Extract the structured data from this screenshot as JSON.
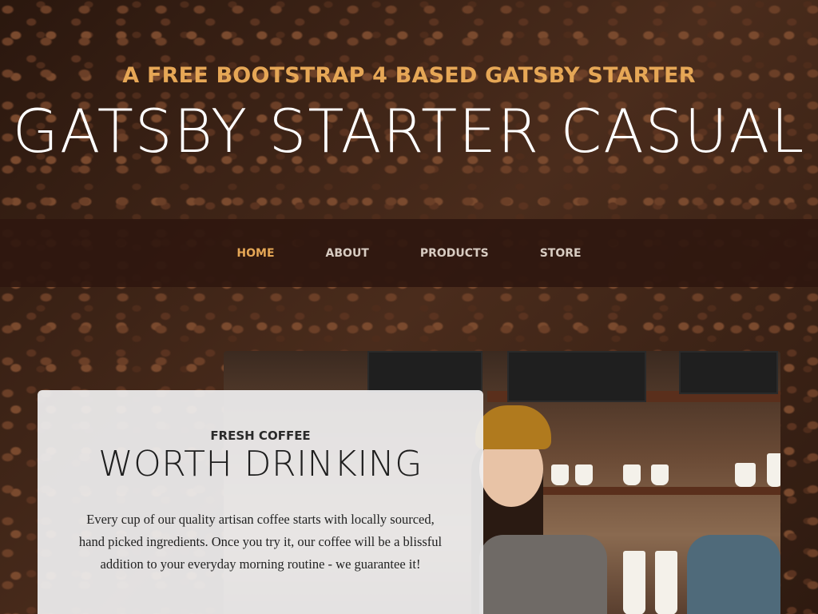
{
  "header": {
    "tagline": "A FREE BOOTSTRAP 4 BASED GATSBY STARTER",
    "site_title": "GATSBY STARTER CASUAL"
  },
  "nav": {
    "items": [
      {
        "label": "HOME",
        "active": true
      },
      {
        "label": "ABOUT",
        "active": false
      },
      {
        "label": "PRODUCTS",
        "active": false
      },
      {
        "label": "STORE",
        "active": false
      }
    ]
  },
  "intro": {
    "subheading": "FRESH COFFEE",
    "heading": "WORTH DRINKING",
    "text": "Every cup of our quality artisan coffee starts with locally sourced, hand picked ingredients. Once you try it, our coffee will be a blissful addition to your everyday morning routine - we guarantee it!"
  },
  "colors": {
    "accent": "#e6a756",
    "nav_bg": "#2f170f",
    "card_bg": "#f0f0f1"
  }
}
